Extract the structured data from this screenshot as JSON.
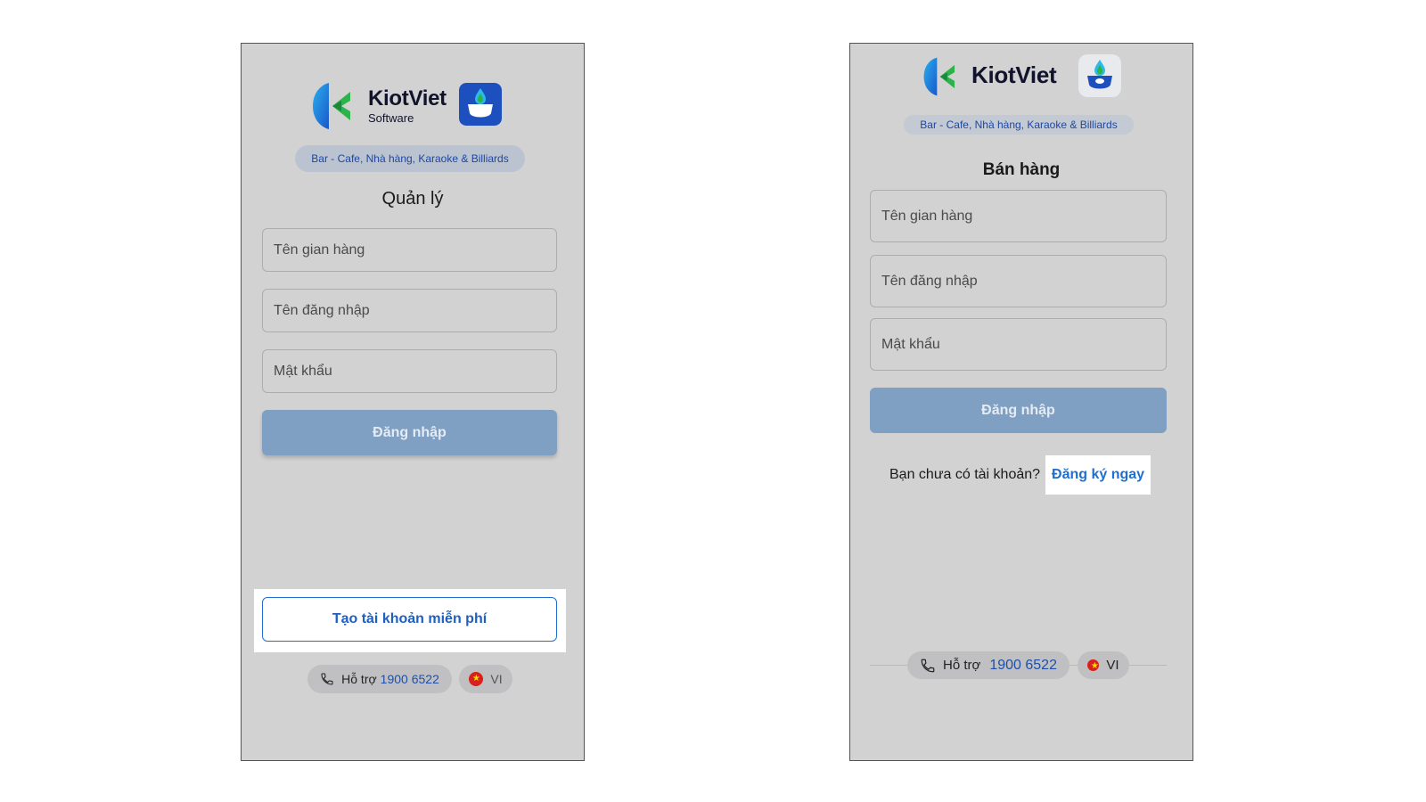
{
  "left": {
    "brand_name": "KiotViet",
    "brand_sub": "Software",
    "industry": "Bar - Cafe, Nhà hàng, Karaoke & Billiards",
    "title": "Quản lý",
    "shop_placeholder": "Tên gian hàng",
    "username_placeholder": "Tên đăng nhập",
    "password_placeholder": "Mật khẩu",
    "login_label": "Đăng nhập",
    "create_account_label": "Tạo tài khoản miễn phí",
    "support_label": "Hỗ trợ",
    "support_phone": "1900 6522",
    "language": "VI"
  },
  "right": {
    "brand_name": "KiotViet",
    "industry": "Bar - Cafe, Nhà hàng, Karaoke & Billiards",
    "title": "Bán hàng",
    "shop_placeholder": "Tên gian hàng",
    "username_placeholder": "Tên đăng nhập",
    "password_placeholder": "Mật khẩu",
    "login_label": "Đăng nhập",
    "no_account_text": "Bạn chưa có tài khoản?",
    "register_link": "Đăng ký ngay",
    "support_label": "Hỗ trợ",
    "support_phone": "1900 6522",
    "language": "VI"
  },
  "colors": {
    "screen_bg": "#d2d2d3",
    "accent_blue": "#1f6fd1",
    "login_disabled": "#80a0c3",
    "pill_bg": "#bac3cf"
  },
  "icons": [
    "kiotviet-logo-icon",
    "fnb-app-icon",
    "phone-icon",
    "vietnam-flag-icon"
  ]
}
